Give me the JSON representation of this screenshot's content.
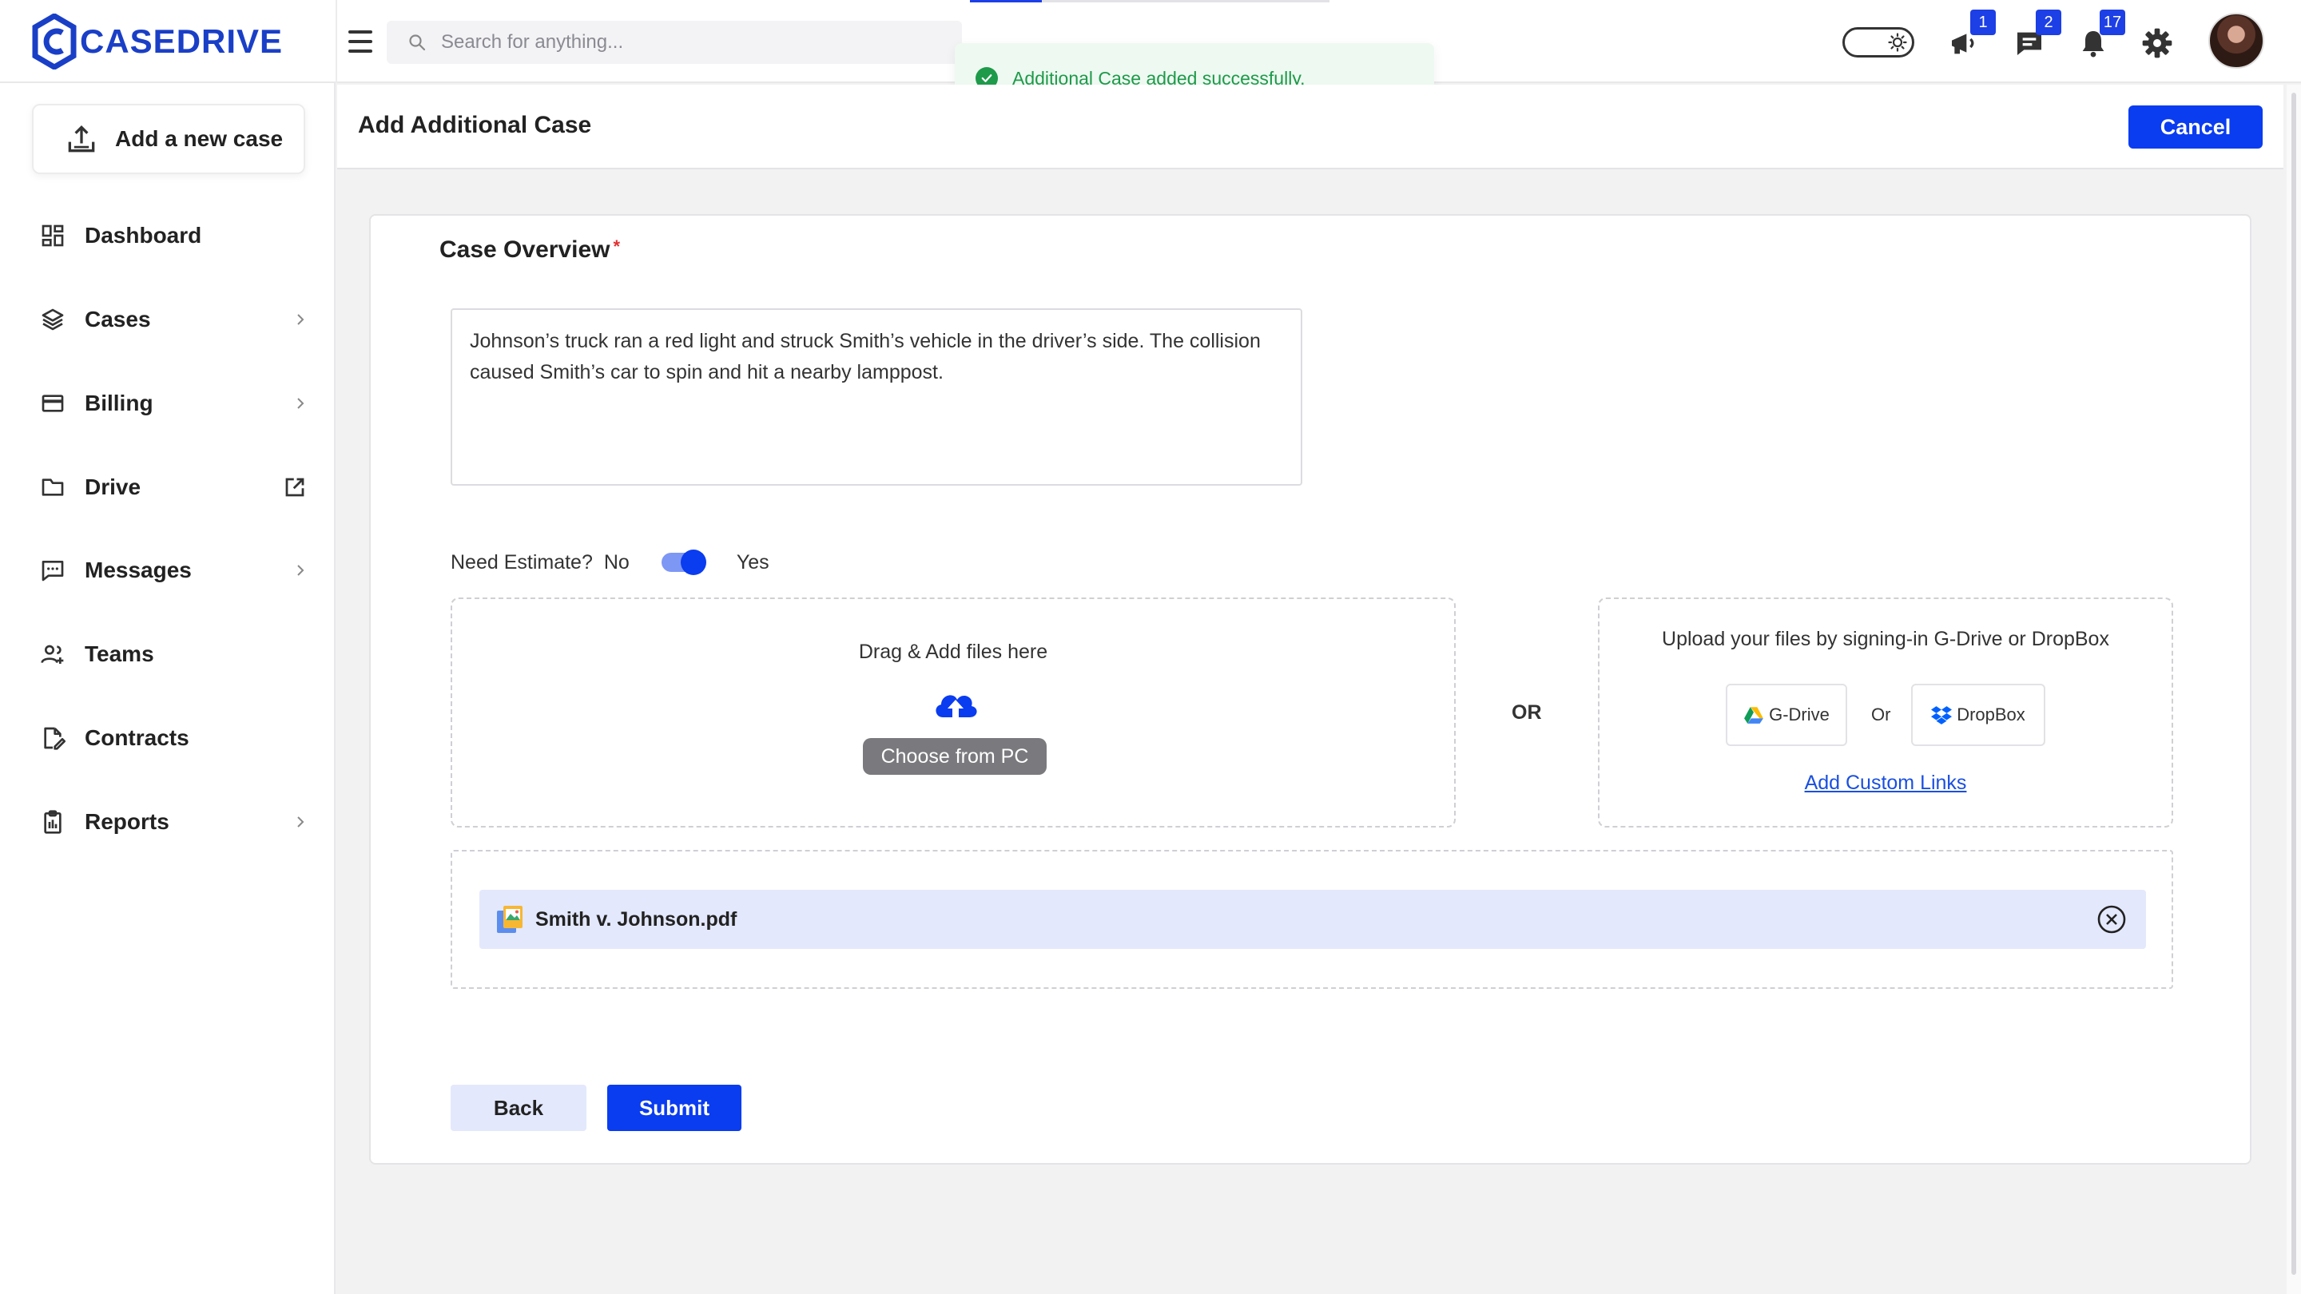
{
  "brand": {
    "name": "CASEDRIVE",
    "color": "#1a3fc7"
  },
  "search": {
    "placeholder": "Search for anything..."
  },
  "toast": {
    "message": "Additional Case added successfully.",
    "color": "#1e9a4a"
  },
  "header": {
    "badges": {
      "announcements": "1",
      "messages": "2",
      "notifications": "17"
    }
  },
  "sidebar": {
    "add_case_label": "Add a new case",
    "items": [
      {
        "label": "Dashboard",
        "icon": "dashboard-icon"
      },
      {
        "label": "Cases",
        "icon": "layers-icon"
      },
      {
        "label": "Billing",
        "icon": "credit-card-icon"
      },
      {
        "label": "Drive",
        "icon": "folder-icon"
      },
      {
        "label": "Messages",
        "icon": "message-icon"
      },
      {
        "label": "Teams",
        "icon": "team-icon"
      },
      {
        "label": "Contracts",
        "icon": "contract-icon"
      },
      {
        "label": "Reports",
        "icon": "clipboard-icon"
      }
    ]
  },
  "page": {
    "title": "Add Additional Case",
    "cancel_label": "Cancel"
  },
  "form": {
    "overview_label": "Case Overview",
    "required_mark": "*",
    "overview_value": "Johnson’s truck ran a red light and struck Smith’s vehicle in the driver’s side. The collision caused Smith’s car to spin and hit a nearby lamppost.",
    "estimate_label": "Need Estimate?",
    "estimate_no": "No",
    "estimate_yes": "Yes",
    "estimate_on": true,
    "dropzone_text": "Drag & Add files here",
    "choose_label": "Choose from PC",
    "or_label": "OR",
    "cloud_text": "Upload your files by signing-in G-Drive or DropBox",
    "gdrive_label": "G-Drive",
    "cloud_or": "Or",
    "dropbox_label": "DropBox",
    "custom_links_label": "Add Custom Links",
    "files": [
      {
        "name": "Smith v. Johnson.pdf"
      }
    ],
    "back_label": "Back",
    "submit_label": "Submit"
  },
  "colors": {
    "primary": "#0a3cf0",
    "toggle_track": "#7d97f5",
    "file_row_bg": "#e3e8fc"
  }
}
